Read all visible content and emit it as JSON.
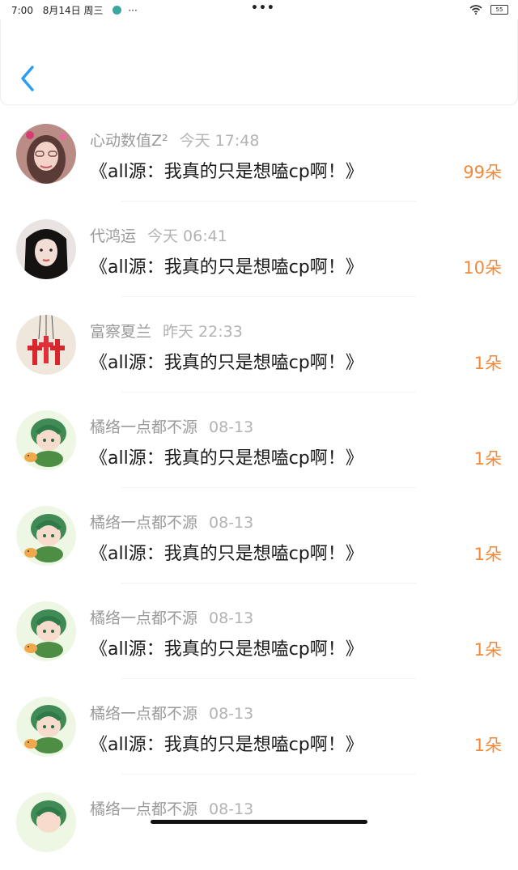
{
  "status": {
    "time": "7:00",
    "date": "8月14日 周三",
    "more": "···",
    "center_dots": "•••",
    "battery": "55"
  },
  "header": {
    "back_icon": "chevron-left-icon",
    "accent": "#2a9df4"
  },
  "rows": [
    {
      "user": "心动数值Z²",
      "time": "今天 17:48",
      "title": "《all源：我真的只是想嗑cp啊！》",
      "count": "99朵",
      "avatar": "girl-photo-1"
    },
    {
      "user": "代鸿运",
      "time": "今天 06:41",
      "title": "《all源：我真的只是想嗑cp啊！》",
      "count": "10朵",
      "avatar": "girl-photo-2"
    },
    {
      "user": "富察夏兰",
      "time": "昨天 22:33",
      "title": "《all源：我真的只是想嗑cp啊！》",
      "count": "1朵",
      "avatar": "red-cross-pendants"
    },
    {
      "user": "橘络一点都不源",
      "time": "08-13",
      "title": "《all源：我真的只是想嗑cp啊！》",
      "count": "1朵",
      "avatar": "chibi-green-hair"
    },
    {
      "user": "橘络一点都不源",
      "time": "08-13",
      "title": "《all源：我真的只是想嗑cp啊！》",
      "count": "1朵",
      "avatar": "chibi-green-hair"
    },
    {
      "user": "橘络一点都不源",
      "time": "08-13",
      "title": "《all源：我真的只是想嗑cp啊！》",
      "count": "1朵",
      "avatar": "chibi-green-hair"
    },
    {
      "user": "橘络一点都不源",
      "time": "08-13",
      "title": "《all源：我真的只是想嗑cp啊！》",
      "count": "1朵",
      "avatar": "chibi-green-hair"
    },
    {
      "user": "橘络一点都不源",
      "time": "08-13",
      "title": "",
      "count": "",
      "avatar": "chibi-green-hair"
    }
  ],
  "colors": {
    "count": "#f08a3a",
    "name": "#9a9a9a",
    "title": "#1a1a1a"
  }
}
